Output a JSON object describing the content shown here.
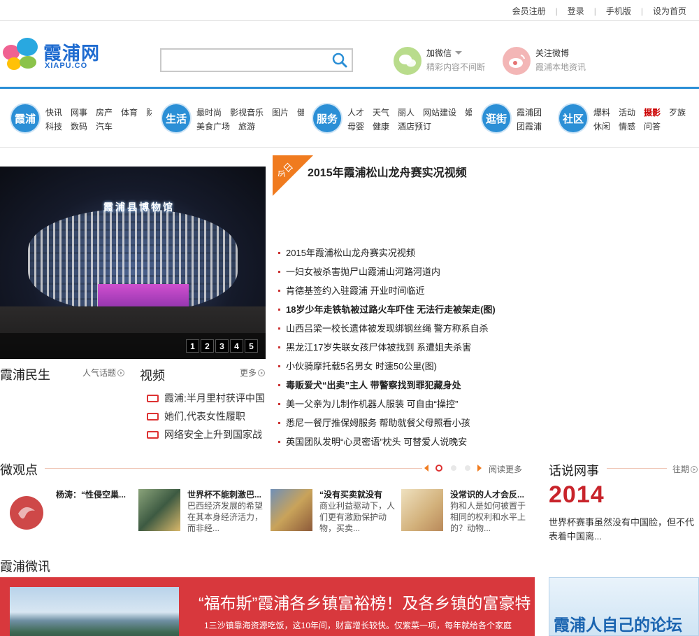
{
  "topbar": {
    "links": [
      "会员注册",
      "登录",
      "手机版",
      "设为首页"
    ]
  },
  "header": {
    "brand": "霞浦网",
    "brand_sub": "XIAPU.CO",
    "search_placeholder": "",
    "weixin": {
      "title": "加微信",
      "sub": "精彩内容不间断"
    },
    "weibo": {
      "title": "关注微博",
      "sub": "霞浦本地资讯"
    }
  },
  "categories": [
    {
      "badge": "霞浦",
      "row1": [
        "快讯",
        "网事",
        "房产",
        "体育",
        "财"
      ],
      "row2": [
        "科技",
        "数码",
        "汽车"
      ]
    },
    {
      "badge": "生活",
      "row1": [
        "最时尚",
        "影视音乐",
        "图片",
        "健"
      ],
      "row2": [
        "美食广场",
        "旅游"
      ]
    },
    {
      "badge": "服务",
      "row1": [
        "人才",
        "天气",
        "丽人",
        "网站建设",
        "婚"
      ],
      "row2": [
        "母婴",
        "健康",
        "酒店预订"
      ]
    },
    {
      "badge": "逛街",
      "row1": [
        "霞浦团"
      ],
      "row2": [
        "团霞浦"
      ]
    },
    {
      "badge": "社区",
      "row1": [
        "爆料",
        "活动",
        "摄影",
        "歹族"
      ],
      "row2": [
        "休闲",
        "情感",
        "问答"
      ]
    }
  ],
  "slider": {
    "sign": "霞浦县博物馆",
    "pages": [
      "1",
      "2",
      "3",
      "4",
      "5"
    ]
  },
  "headline": {
    "tag": "今日",
    "title": "2015年霞浦松山龙舟赛实况视频"
  },
  "news": [
    {
      "text": "2015年霞浦松山龙舟赛实况视频",
      "bold": false
    },
    {
      "text": "一妇女被杀害抛尸山霞浦山河路河道内",
      "bold": false
    },
    {
      "text": "肯德基签约入驻霞浦 开业时间临近",
      "bold": false
    },
    {
      "text": "18岁少年走铁轨被过路火车吓住 无法行走被架走(图)",
      "bold": true
    },
    {
      "text": "山西吕梁一校长遗体被发现绑钢丝绳 警方称系自杀",
      "bold": false
    },
    {
      "text": "黑龙江17岁失联女孩尸体被找到 系遭姐夫杀害",
      "bold": false
    },
    {
      "text": "小伙骑摩托载5名男女 时速50公里(图)",
      "bold": false
    },
    {
      "text": "毒贩爱犬“出卖”主人 带警察找到罪犯藏身处",
      "bold": true
    },
    {
      "text": "美一父亲为儿制作机器人服装 可自由“操控”",
      "bold": false
    },
    {
      "text": "悉尼一餐厅推保姆服务 帮助就餐父母照看小孩",
      "bold": false
    },
    {
      "text": "英国团队发明“心灵密语”枕头 可替爱人说晚安",
      "bold": false
    }
  ],
  "minsheng": {
    "title": "霞浦民生",
    "more": "人气话题"
  },
  "video": {
    "title": "视频",
    "more": "更多",
    "items": [
      "霞浦:半月里村获评中国",
      "她们,代表女性履职",
      "网络安全上升到国家战"
    ]
  },
  "weiguandian": {
    "title": "微观点",
    "more": "阅读更多",
    "items": [
      {
        "title": "杨涛：“性侵空巢...",
        "desc": ""
      },
      {
        "title": "世界杯不能刺激巴...",
        "desc": "巴西经济发展的希望在其本身经济活力，而非经..."
      },
      {
        "title": "“没有买卖就没有",
        "desc": "商业利益驱动下，人们更有激励保护动物，买卖..."
      },
      {
        "title": "没常识的人才会反...",
        "desc": "狗和人是如何被置于相同的权利和水平上的？动物..."
      }
    ]
  },
  "huashuo": {
    "title": "话说网事",
    "more": "往期",
    "year": "2014",
    "desc": "世界杯赛事虽然没有中国脸，但不代表着中国离..."
  },
  "weixun": {
    "title": "霞浦微讯",
    "headline": "“福布斯”霞浦各乡镇富裕榜！及各乡镇的富豪特",
    "desc": "1三沙镇靠海资源吃饭，这10年间，财富增长较快。仅紫菜一项，每年就给各个家庭"
  },
  "forum": {
    "title": "霞浦人自己的论坛"
  },
  "colors": {
    "accent": "#2b8fd6",
    "red": "#c8242b",
    "panel": "#d8383d"
  }
}
